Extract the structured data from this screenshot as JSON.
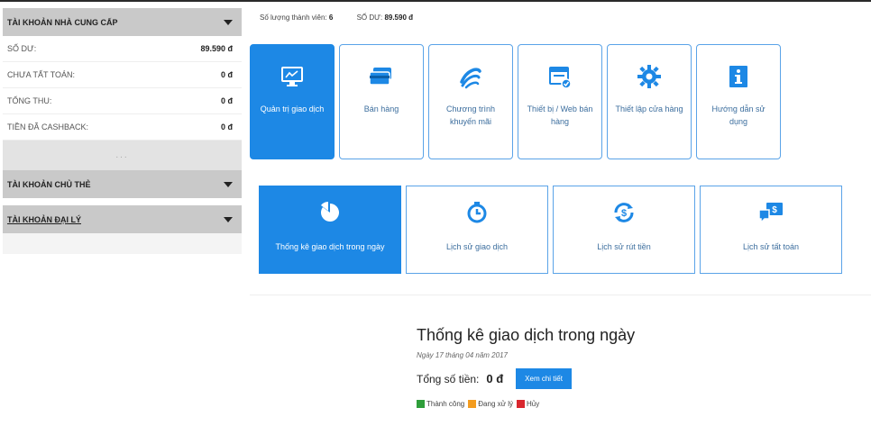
{
  "colors": {
    "accent": "#1d88e5",
    "success": "#2e9e3a",
    "pending": "#f39c1f",
    "cancel": "#d9272e"
  },
  "sidebar": {
    "section1": {
      "title": "TÀI KHOẢN NHÀ CUNG CẤP"
    },
    "rows": [
      {
        "label": "SỐ DƯ:",
        "value": "89.590 đ"
      },
      {
        "label": "CHƯA TẤT TOÁN:",
        "value": "0 đ"
      },
      {
        "label": "TỔNG THU:",
        "value": "0 đ"
      },
      {
        "label": "TIỀN ĐÃ CASHBACK:",
        "value": "0 đ"
      }
    ],
    "more": "...",
    "section2": {
      "title": "TÀI KHOẢN CHỦ THẺ"
    },
    "section3": {
      "title": "TÀI KHOẢN ĐẠI LÝ"
    }
  },
  "stats": {
    "members_label": "Số lượng thành viên:",
    "members_value": "6",
    "balance_label": "SỐ DƯ:",
    "balance_value": "89.590 đ"
  },
  "tiles": [
    {
      "label": "Quản trị giao dịch",
      "icon": "monitor-chart-icon"
    },
    {
      "label": "Bán hàng",
      "icon": "cards-icon"
    },
    {
      "label": "Chương trình khuyến mãi",
      "icon": "swirl-icon"
    },
    {
      "label": "Thiết bị / Web bán hàng",
      "icon": "browser-window-icon"
    },
    {
      "label": "Thiết lập cửa hàng",
      "icon": "gear-icon"
    },
    {
      "label": "Hướng dẫn sử dụng",
      "icon": "info-icon"
    }
  ],
  "subtiles": [
    {
      "label": "Thống kê giao dịch trong ngày",
      "icon": "pie-chart-icon"
    },
    {
      "label": "Lịch sử giao dịch",
      "icon": "clock-icon"
    },
    {
      "label": "Lịch sử rút tiền",
      "icon": "dollar-refresh-icon"
    },
    {
      "label": "Lịch sử tất toán",
      "icon": "money-chat-icon"
    }
  ],
  "panel": {
    "title": "Thống kê giao dịch trong ngày",
    "date": "Ngày 17 tháng 04 năm 2017",
    "total_label": "Tổng số tiền:",
    "total_value": "0 đ",
    "detail_button": "Xem chi tiết",
    "legend": [
      "Thành công",
      "Đang xử lý",
      "Hủy"
    ]
  }
}
